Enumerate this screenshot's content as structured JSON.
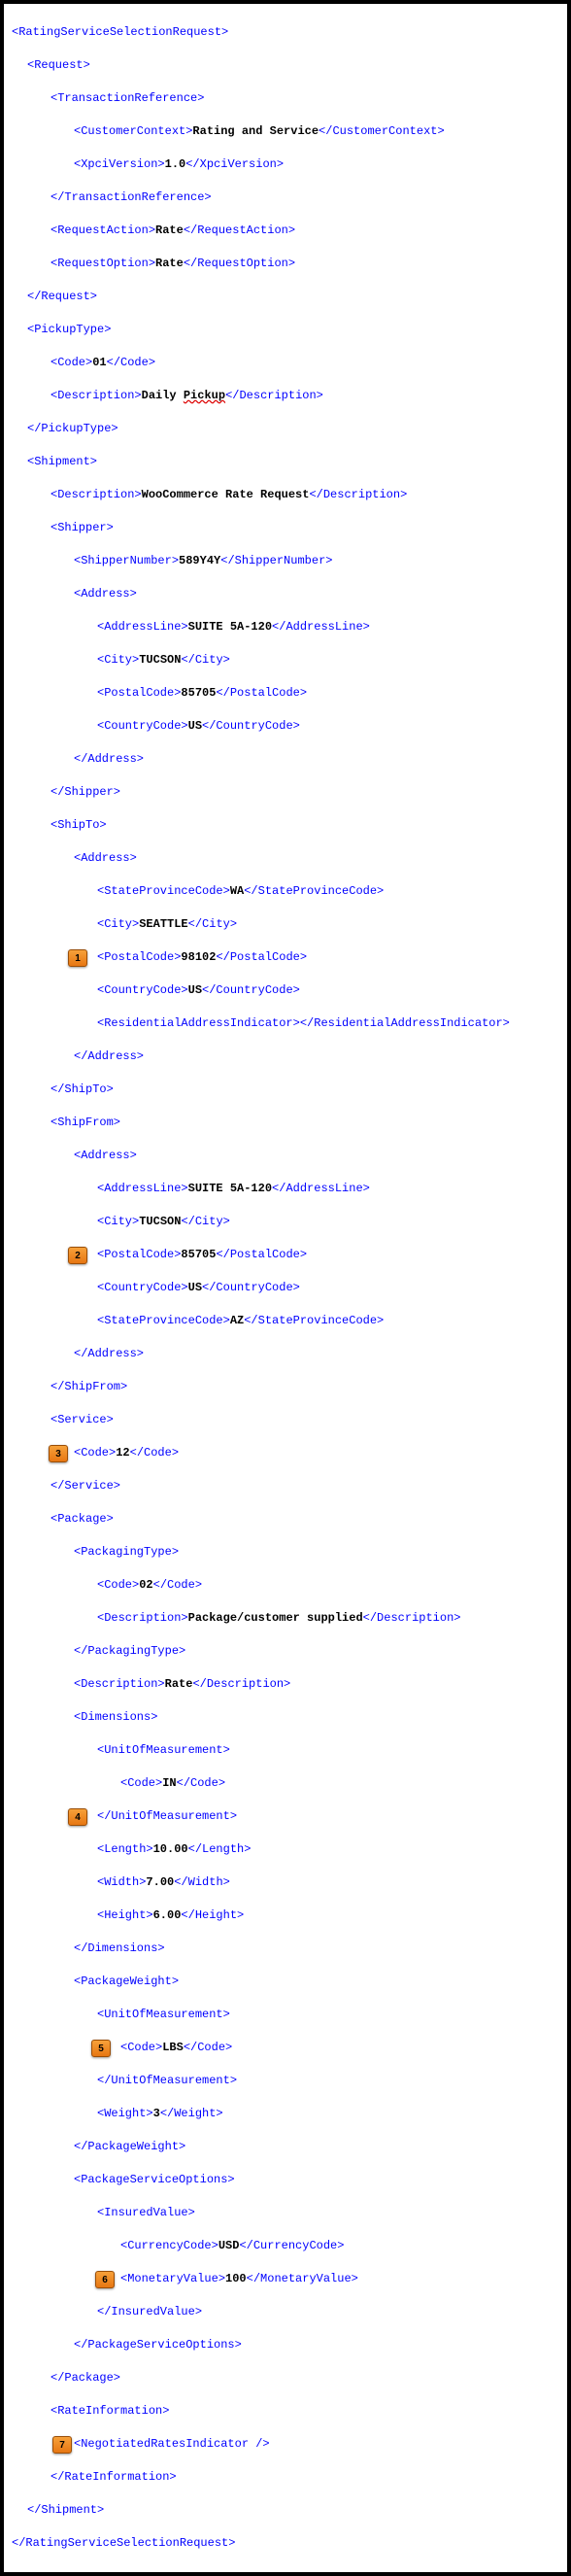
{
  "badges": {
    "b1": "1",
    "b2": "2",
    "b3": "3",
    "b4": "4",
    "b5": "5",
    "b6": "6",
    "b7": "7"
  },
  "t": {
    "root_o": "<RatingServiceSelectionRequest>",
    "root_c": "</RatingServiceSelectionRequest>",
    "req_o": "<Request>",
    "req_c": "</Request>",
    "tref_o": "<TransactionReference>",
    "tref_c": "</TransactionReference>",
    "cc_o": "<CustomerContext>",
    "cc_c": "</CustomerContext>",
    "cc_v": "Rating and Service",
    "xv_o": "<XpciVersion>",
    "xv_c": "</XpciVersion>",
    "xv_v": "1.0",
    "ra_o": "<RequestAction>",
    "ra_c": "</RequestAction>",
    "ra_v": "Rate",
    "ro_o": "<RequestOption>",
    "ro_c": "</RequestOption>",
    "ro_v": "Rate",
    "pt_o": "<PickupType>",
    "pt_c": "</PickupType>",
    "code_o": "<Code>",
    "code_c": "</Code>",
    "pt_code": "01",
    "pt_desc_a": "Daily ",
    "pt_desc_b": "Pickup",
    "desc_o": "<Description>",
    "desc_c": "</Description>",
    "ship_o": "<Shipment>",
    "ship_c": "</Shipment>",
    "ship_desc": "WooCommerce Rate Request",
    "shipper_o": "<Shipper>",
    "shipper_c": "</Shipper>",
    "sn_o": "<ShipperNumber>",
    "sn_c": "</ShipperNumber>",
    "sn_v": "589Y4Y",
    "addr_o": "<Address>",
    "addr_c": "</Address>",
    "al_o": "<AddressLine>",
    "al_c": "</AddressLine>",
    "al_v": "SUITE 5A-120",
    "city_o": "<City>",
    "city_c": "</City>",
    "city_tuc": "TUCSON",
    "city_sea": "SEATTLE",
    "pc_o": "<PostalCode>",
    "pc_c": "</PostalCode>",
    "pc_85705": "85705",
    "pc_98102": "98102",
    "co_o": "<CountryCode>",
    "co_c": "</CountryCode>",
    "co_us": "US",
    "shipto_o": "<ShipTo>",
    "shipto_c": "</ShipTo>",
    "spc_o": "<StateProvinceCode>",
    "spc_c": "</StateProvinceCode>",
    "spc_wa": "WA",
    "spc_az": "AZ",
    "rai_o": "<ResidentialAddressIndicator>",
    "rai_c": "</ResidentialAddressIndicator>",
    "shipfrom_o": "<ShipFrom>",
    "shipfrom_c": "</ShipFrom>",
    "svc_o": "<Service>",
    "svc_c": "</Service>",
    "svc_code": "12",
    "pkg_o": "<Package>",
    "pkg_c": "</Package>",
    "pkt_o": "<PackagingType>",
    "pkt_c": "</PackagingType>",
    "pkt_code": "02",
    "pkt_desc": "Package/customer supplied",
    "pkg_desc": "Rate",
    "dim_o": "<Dimensions>",
    "dim_c": "</Dimensions>",
    "uom_o": "<UnitOfMeasurement>",
    "uom_c": "</UnitOfMeasurement>",
    "uom_in": "IN",
    "uom_lbs": "LBS",
    "len_o": "<Length>",
    "len_c": "</Length>",
    "len_v": "10.00",
    "wid_o": "<Width>",
    "wid_c": "</Width>",
    "wid_v": "7.00",
    "hei_o": "<Height>",
    "hei_c": "</Height>",
    "hei_v": "6.00",
    "pw_o": "<PackageWeight>",
    "pw_c": "</PackageWeight>",
    "wt_o": "<Weight>",
    "wt_c": "</Weight>",
    "wt_v": "3",
    "pso_o": "<PackageServiceOptions>",
    "pso_c": "</PackageServiceOptions>",
    "iv_o": "<InsuredValue>",
    "iv_c": "</InsuredValue>",
    "cur_o": "<CurrencyCode>",
    "cur_c": "</CurrencyCode>",
    "cur_v": "USD",
    "mv_o": "<MonetaryValue>",
    "mv_c": "</MonetaryValue>",
    "mv_v": "100",
    "ri_o": "<RateInformation>",
    "ri_c": "</RateInformation>",
    "nri": "<NegotiatedRatesIndicator />"
  }
}
